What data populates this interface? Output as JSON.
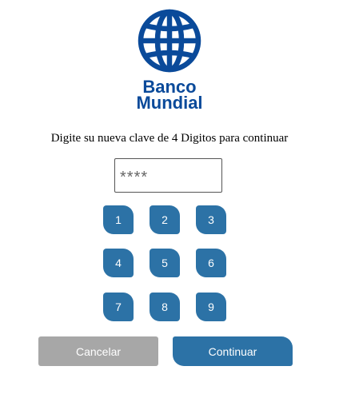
{
  "logo": {
    "line1": "Banco",
    "line2": "Mundial",
    "color": "#0a4a9a",
    "icon": "globe-icon"
  },
  "prompt": "Digite su nueva clave de 4 Digitos para continuar",
  "pin": {
    "placeholder": "****",
    "value": ""
  },
  "keypad": {
    "keys": [
      "1",
      "2",
      "3",
      "4",
      "5",
      "6",
      "7",
      "8",
      "9"
    ]
  },
  "actions": {
    "cancel_label": "Cancelar",
    "continue_label": "Continuar"
  },
  "colors": {
    "primary": "#2c72a6",
    "secondary": "#a7a7a7"
  }
}
